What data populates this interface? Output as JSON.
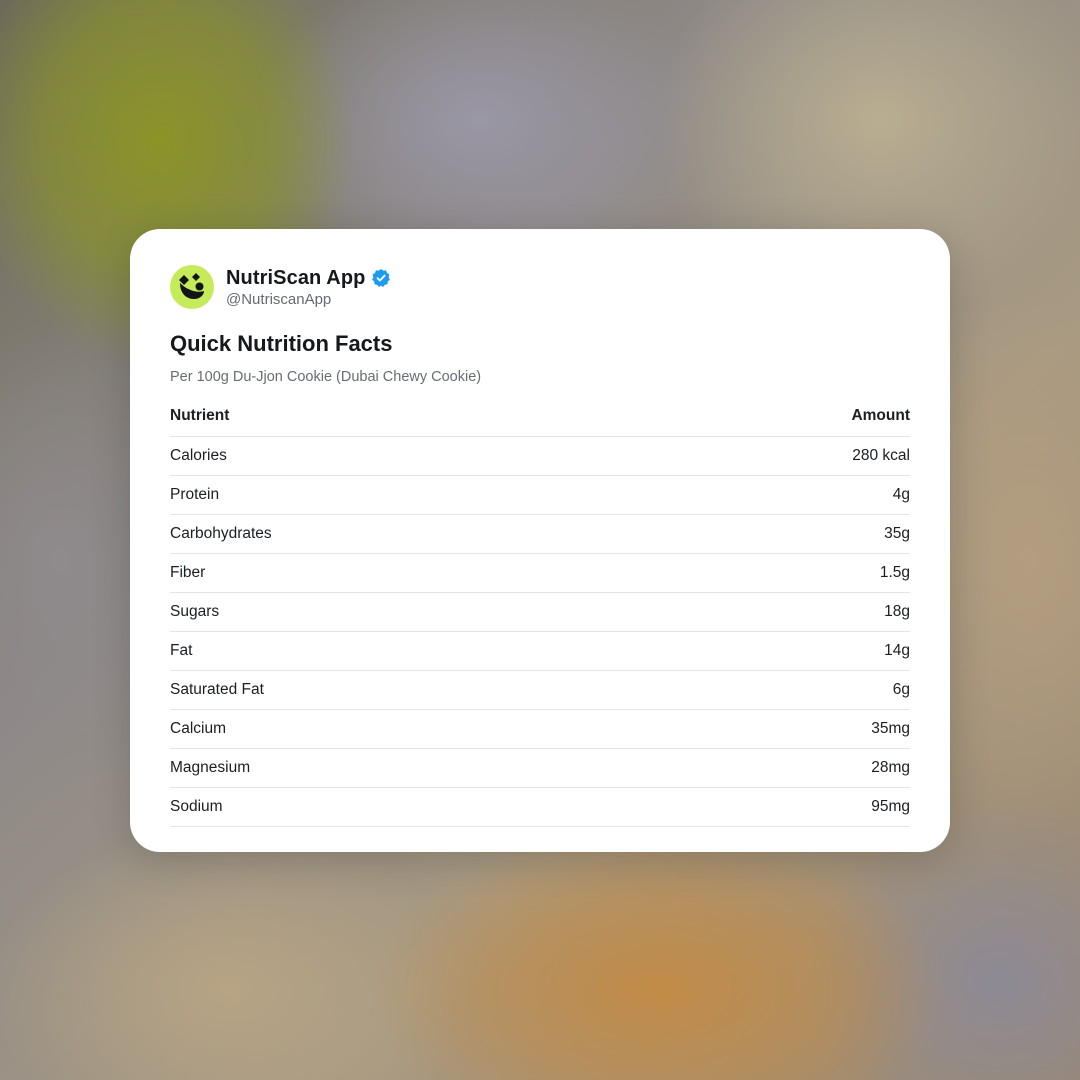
{
  "account": {
    "name": "NutriScan App",
    "handle": "@NutriscanApp",
    "verified": true,
    "avatar_color": "#c5ea5a",
    "verified_color": "#1d9bf0"
  },
  "card": {
    "title": "Quick Nutrition Facts",
    "subtitle": "Per 100g Du-Jjon Cookie (Dubai Chewy Cookie)"
  },
  "table": {
    "headers": [
      "Nutrient",
      "Amount"
    ],
    "rows": [
      {
        "nutrient": "Calories",
        "amount": "280 kcal"
      },
      {
        "nutrient": "Protein",
        "amount": "4g"
      },
      {
        "nutrient": "Carbohydrates",
        "amount": "35g"
      },
      {
        "nutrient": "Fiber",
        "amount": "1.5g"
      },
      {
        "nutrient": "Sugars",
        "amount": "18g"
      },
      {
        "nutrient": "Fat",
        "amount": "14g"
      },
      {
        "nutrient": "Saturated Fat",
        "amount": "6g"
      },
      {
        "nutrient": "Calcium",
        "amount": "35mg"
      },
      {
        "nutrient": "Magnesium",
        "amount": "28mg"
      },
      {
        "nutrient": "Sodium",
        "amount": "95mg"
      }
    ]
  },
  "icons": {
    "avatar": "nutriscan-logo-icon",
    "verified": "verified-badge-icon"
  }
}
